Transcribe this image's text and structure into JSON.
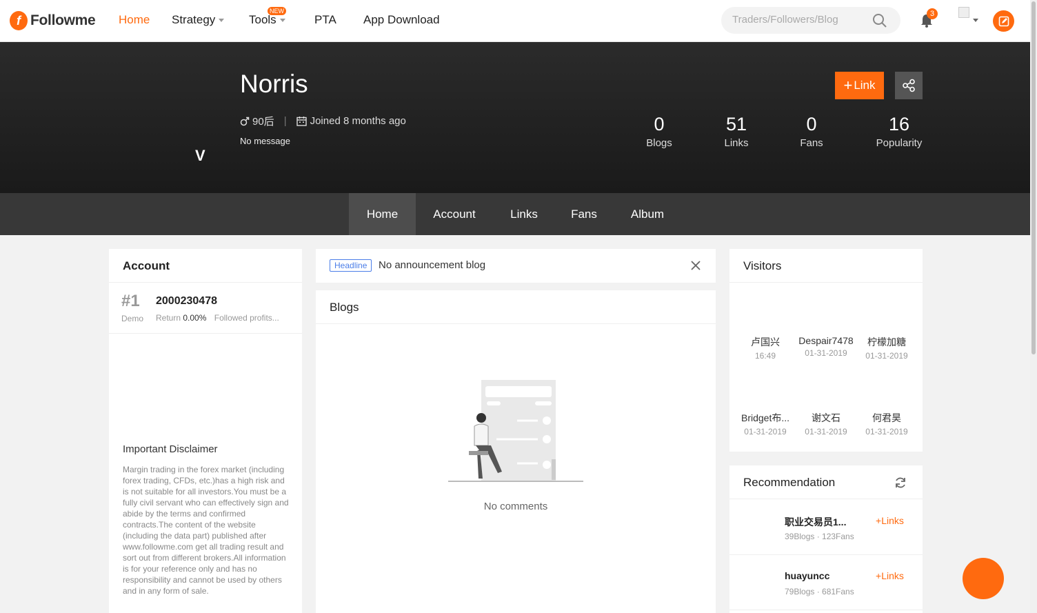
{
  "nav": {
    "logo_text": "Followme",
    "links": [
      "Home",
      "Strategy",
      "Tools",
      "PTA",
      "App Download"
    ],
    "new_badge": "NEW",
    "search_placeholder": "Traders/Followers/Blog",
    "notification_count": "3"
  },
  "profile": {
    "name": "Norris",
    "vip_mark": "V",
    "gender_age": "90后",
    "joined": "Joined 8 months ago",
    "message": "No message",
    "link_button": "Link",
    "stats": [
      {
        "num": "0",
        "label": "Blogs"
      },
      {
        "num": "51",
        "label": "Links"
      },
      {
        "num": "0",
        "label": "Fans"
      },
      {
        "num": "16",
        "label": "Popularity"
      }
    ]
  },
  "tabs": [
    "Home",
    "Account",
    "Links",
    "Fans",
    "Album"
  ],
  "account_card": {
    "title": "Account",
    "rank": "#1",
    "type": "Demo",
    "number": "2000230478",
    "return_label": "Return",
    "return_value": "0.00%",
    "followed": "Followed profits...",
    "disclaimer_title": "Important Disclaimer",
    "disclaimer_text": "Margin trading in the forex market (including forex trading, CFDs, etc.)has a high risk and is not suitable for all investors.You must be a fully civil servant who can effectively sign and abide by the terms and confirmed contracts.The content of the website (including the data part) published after www.followme.com get all trading result and sort out from different brokers.All information is for your reference only and has no responsibility and cannot be used by others and in any form of sale."
  },
  "headline": {
    "badge": "Headline",
    "text": "No announcement blog"
  },
  "blogs": {
    "title": "Blogs",
    "empty": "No comments"
  },
  "visitors": {
    "title": "Visitors",
    "items": [
      {
        "name": "卢国兴",
        "date": "16:49"
      },
      {
        "name": "Despair7478",
        "date": "01-31-2019"
      },
      {
        "name": "柠檬加糖",
        "date": "01-31-2019"
      },
      {
        "name": "Bridget布...",
        "date": "01-31-2019"
      },
      {
        "name": "谢文石",
        "date": "01-31-2019"
      },
      {
        "name": "何君昊",
        "date": "01-31-2019"
      }
    ]
  },
  "recommendation": {
    "title": "Recommendation",
    "items": [
      {
        "name": "职业交易员1...",
        "meta": "39Blogs · 123Fans",
        "link": "Links"
      },
      {
        "name": "huayuncc",
        "meta": "79Blogs · 681Fans",
        "link": "Links"
      }
    ]
  },
  "colors": {
    "accent": "#ff6a0f",
    "header_bg": "#222222",
    "tabs_bg": "#383838"
  }
}
